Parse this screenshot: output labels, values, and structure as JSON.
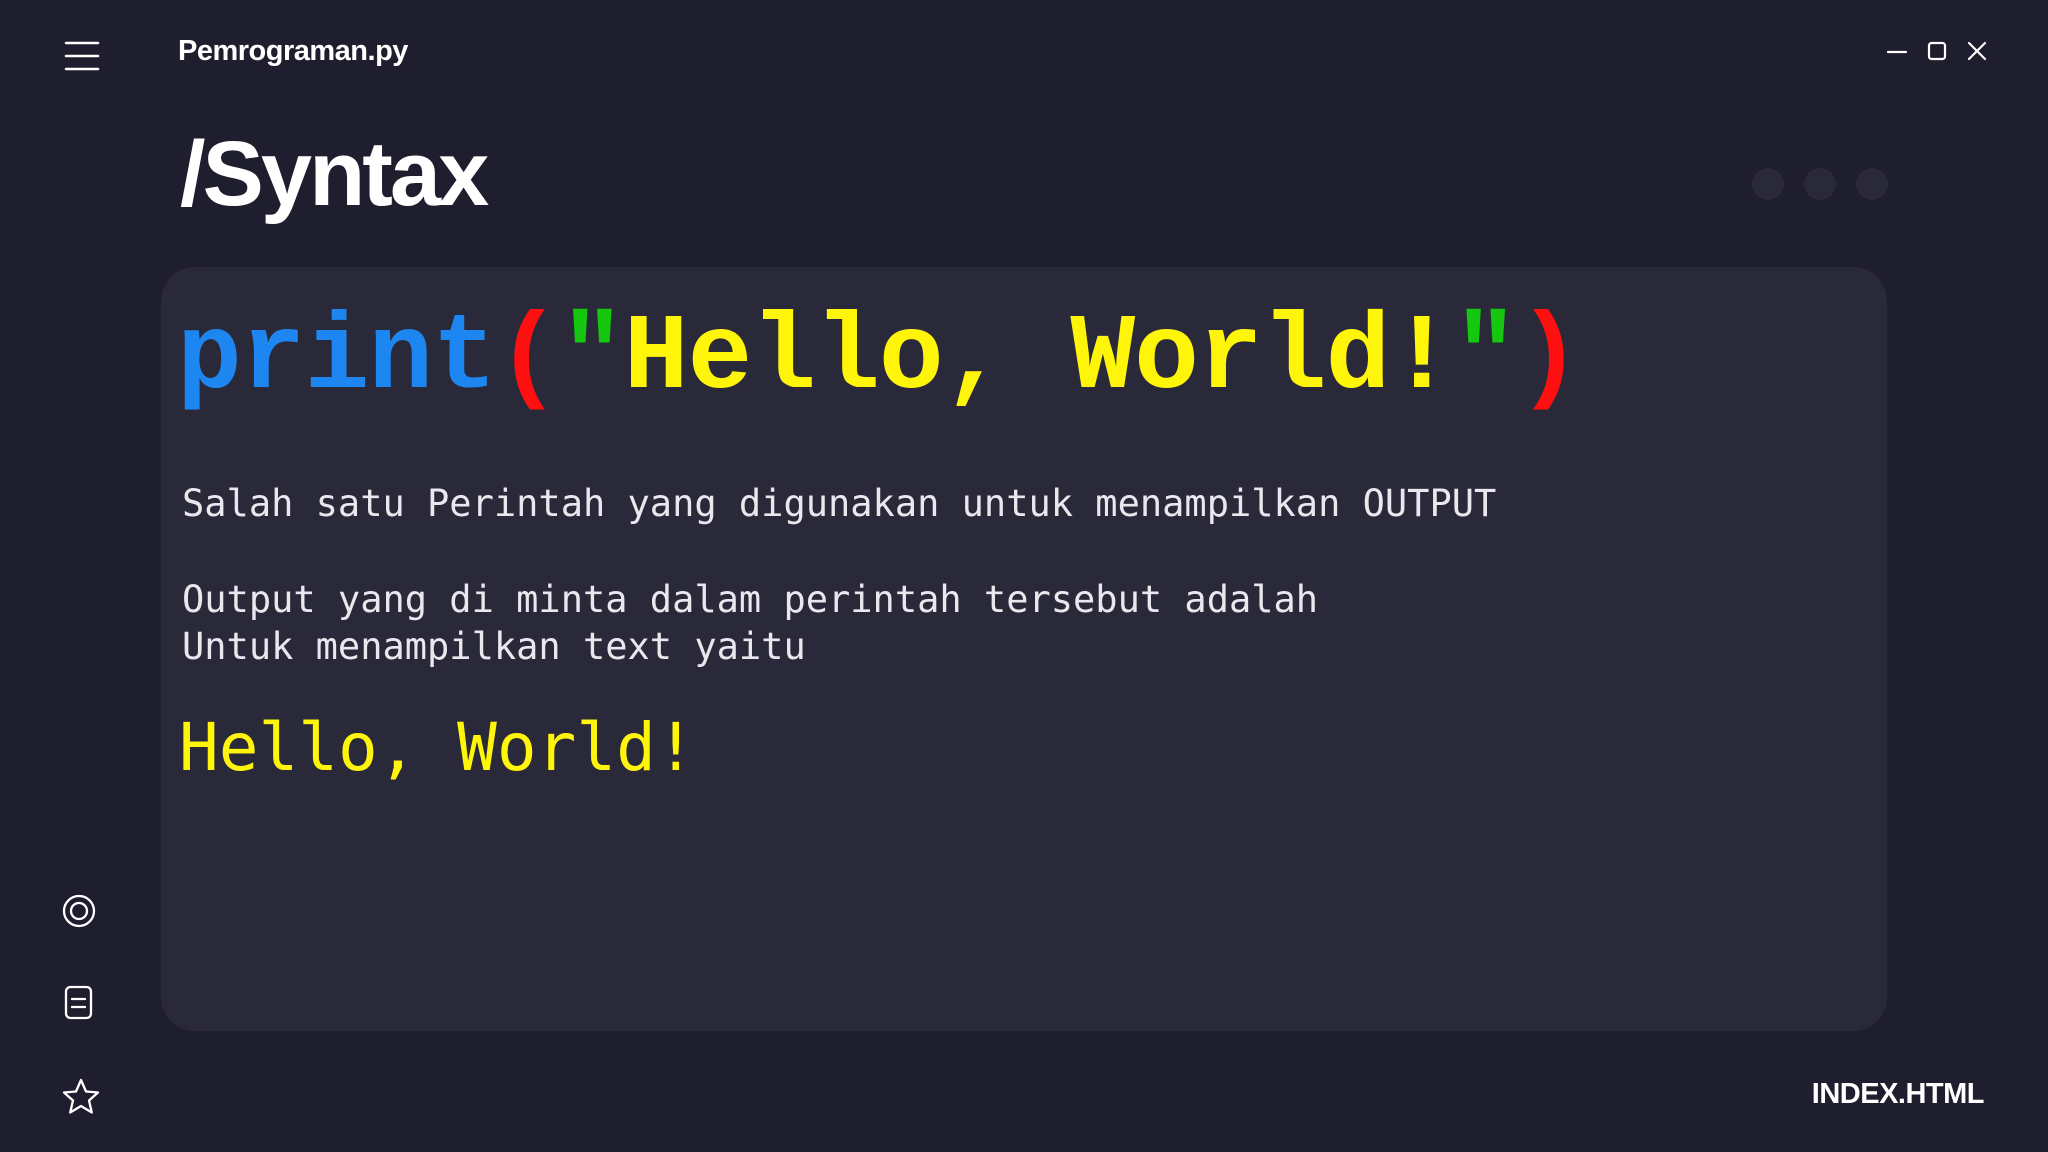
{
  "header": {
    "app_title": "Pemrograman.py",
    "icons": [
      "hamburger-menu-icon",
      "minimize-icon",
      "maximize-icon",
      "close-icon"
    ]
  },
  "page": {
    "title": "/Syntax"
  },
  "code": {
    "function": "print",
    "open_paren": "(",
    "open_quote": "\"",
    "string": "Hello, World!",
    "close_quote": "\"",
    "close_paren": ")"
  },
  "description": {
    "line1": "Salah satu Perintah yang digunakan untuk menampilkan OUTPUT",
    "line2": "Output yang di minta dalam perintah tersebut adalah",
    "line3": "Untuk menampilkan text yaitu"
  },
  "output": {
    "text": "Hello, World!"
  },
  "sidebar": {
    "icons": [
      "target-icon",
      "document-icon",
      "star-icon"
    ]
  },
  "footer": {
    "label": "INDEX.HTML"
  },
  "colors": {
    "background": "#1f1e2e",
    "card": "#2a2939",
    "function": "#1e86f0",
    "paren": "#ff1010",
    "quote": "#15c80f",
    "string": "#fff50a"
  }
}
